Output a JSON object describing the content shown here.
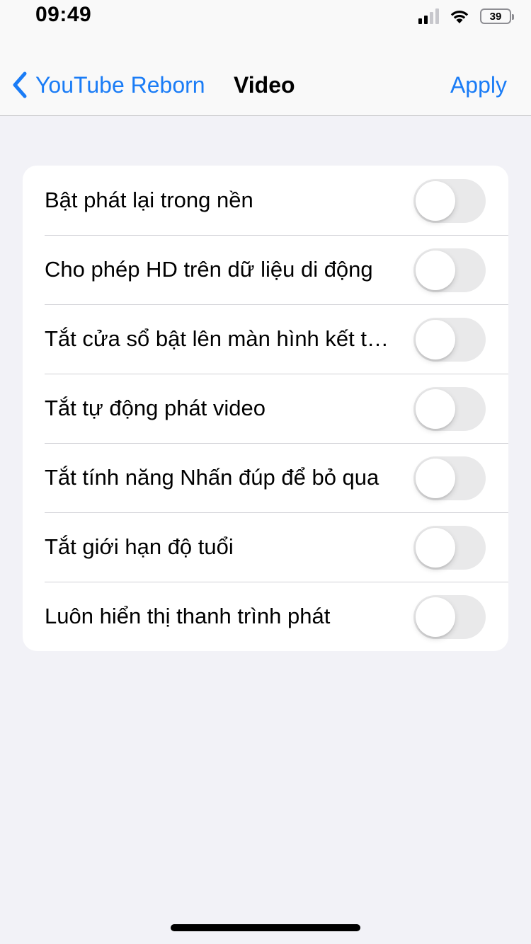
{
  "status_bar": {
    "time": "09:49",
    "battery": "39"
  },
  "nav": {
    "back_label": "YouTube Reborn",
    "title": "Video",
    "apply_label": "Apply"
  },
  "settings": {
    "items": [
      {
        "label": "Bật phát lại trong nền",
        "enabled": false
      },
      {
        "label": "Cho phép HD trên dữ liệu di động",
        "enabled": false
      },
      {
        "label": "Tắt cửa sổ bật lên màn hình kết thúc",
        "enabled": false
      },
      {
        "label": "Tắt tự động phát video",
        "enabled": false
      },
      {
        "label": "Tắt tính năng Nhấn đúp để bỏ qua",
        "enabled": false
      },
      {
        "label": "Tắt giới hạn độ tuổi",
        "enabled": false
      },
      {
        "label": "Luôn hiển thị thanh trình phát",
        "enabled": false
      }
    ]
  },
  "colors": {
    "accent": "#1a7cf6",
    "toggle_off": "#e9e9ea",
    "background": "#f2f2f7"
  }
}
